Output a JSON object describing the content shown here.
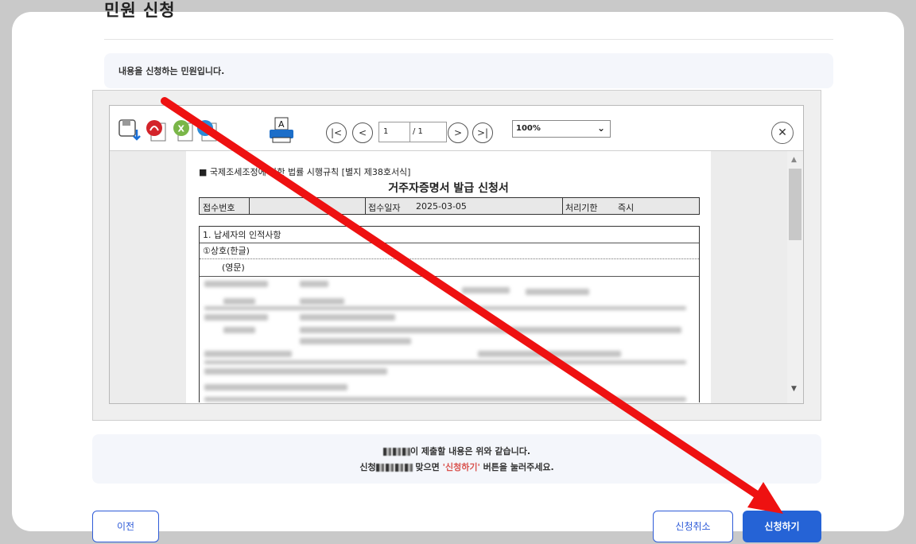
{
  "page": {
    "title": "민원 신청"
  },
  "info": {
    "text": "내용을 신청하는 민원입니다."
  },
  "viewer": {
    "toolbar": {
      "page_current": "1",
      "page_total": "/ 1",
      "zoom": "100%",
      "print_label": "A"
    },
    "document": {
      "heading": "■ 국제조세조정에 관한 법률 시행규칙 [별지 제38호서식]",
      "title": "거주자증명서 발급 신청서",
      "receipt_no_label": "접수번호",
      "receipt_date_label": "접수일자",
      "receipt_date_value": "2025-03-05",
      "deadline_label": "처리기한",
      "deadline_value": "즉시",
      "section1": "1. 납세자의 인적사항",
      "trade_name_kr": "①상호(한글)",
      "trade_name_en": "(영문)"
    }
  },
  "notice": {
    "line1_suffix": "이 제출할 내용은 위와 같습니다.",
    "line2_prefix": "신청",
    "line2_mid": " 맞으면 ",
    "line2_highlight": "'신청하기'",
    "line2_suffix": " 버튼을 눌러주세요."
  },
  "buttons": {
    "prev": "이전",
    "cancel": "신청취소",
    "apply": "신청하기"
  },
  "colors": {
    "primary": "#2563d6",
    "arrow": "#ee1111",
    "highlight": "#d9534f"
  }
}
